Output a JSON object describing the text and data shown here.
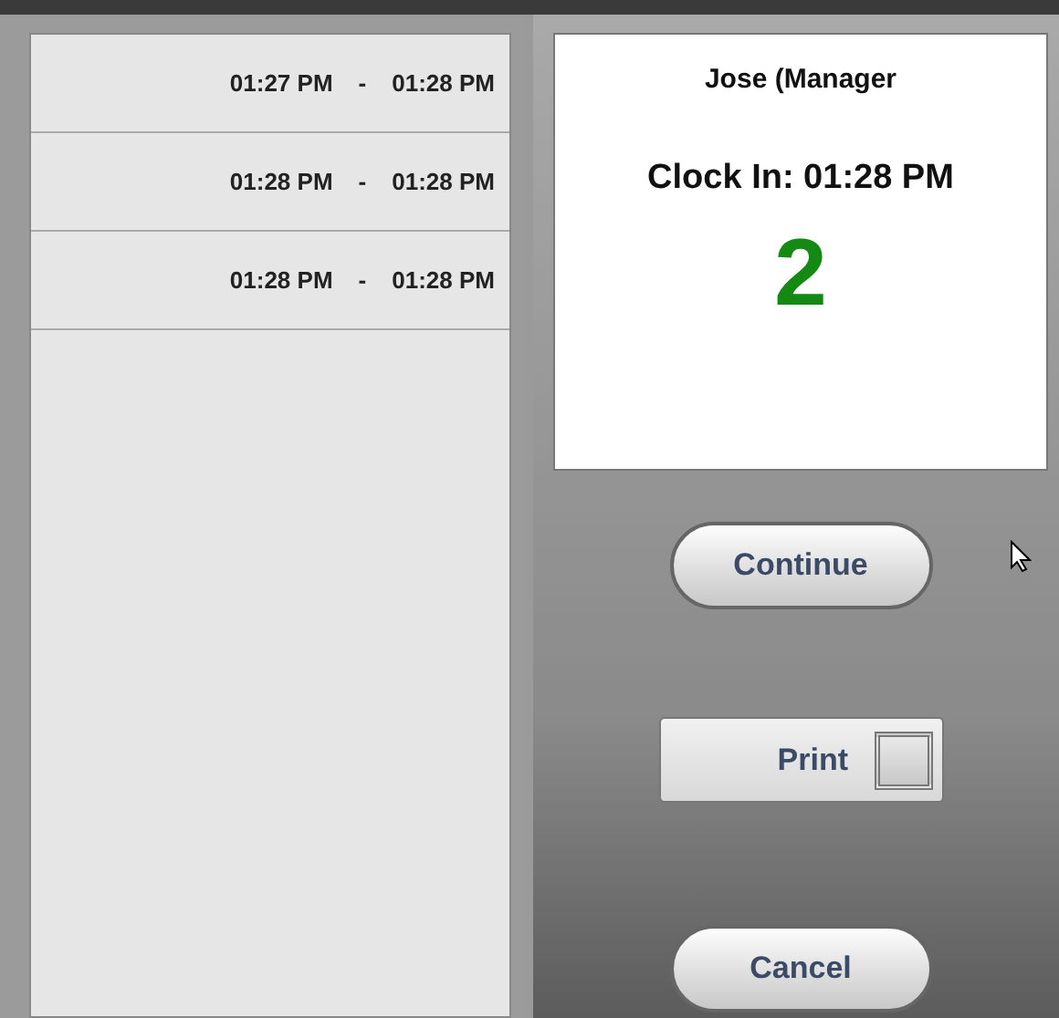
{
  "shifts": [
    {
      "start": "01:27 PM",
      "separator": "-",
      "end": "01:28 PM"
    },
    {
      "start": "01:28 PM",
      "separator": "-",
      "end": "01:28 PM"
    },
    {
      "start": "01:28 PM",
      "separator": "-",
      "end": "01:28 PM"
    }
  ],
  "employee": {
    "name": "Jose (Manager",
    "clock_in": "Clock In: 01:28 PM",
    "count": "2"
  },
  "continue_button": "Continue",
  "print": {
    "label": "Print",
    "checked": false
  },
  "cancel_button": "Cancel"
}
